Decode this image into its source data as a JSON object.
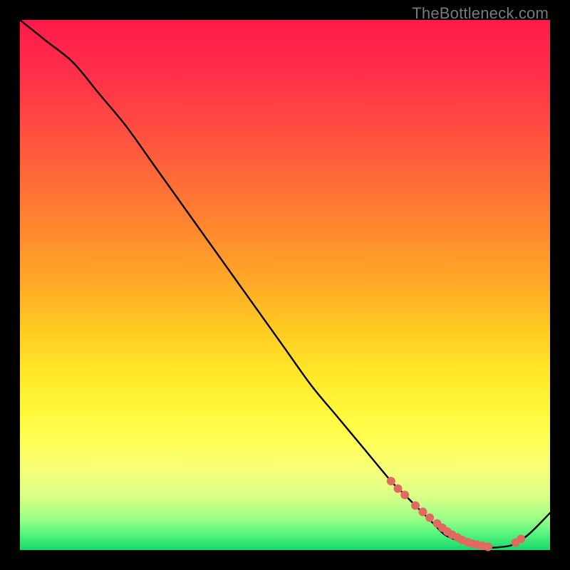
{
  "watermark": "TheBottleneck.com",
  "gradient": {
    "stops": [
      {
        "pos": 0.0,
        "color": "#ff1a4a"
      },
      {
        "pos": 0.1,
        "color": "#ff2f49"
      },
      {
        "pos": 0.2,
        "color": "#ff4b41"
      },
      {
        "pos": 0.3,
        "color": "#ff6a38"
      },
      {
        "pos": 0.4,
        "color": "#ff8a2e"
      },
      {
        "pos": 0.5,
        "color": "#ffab26"
      },
      {
        "pos": 0.58,
        "color": "#ffc922"
      },
      {
        "pos": 0.66,
        "color": "#ffe627"
      },
      {
        "pos": 0.74,
        "color": "#fff83b"
      },
      {
        "pos": 0.8,
        "color": "#ffff58"
      },
      {
        "pos": 0.85,
        "color": "#f6ff7a"
      },
      {
        "pos": 0.9,
        "color": "#d8ff88"
      },
      {
        "pos": 0.94,
        "color": "#9dff86"
      },
      {
        "pos": 0.97,
        "color": "#55f57e"
      },
      {
        "pos": 1.0,
        "color": "#17d66a"
      }
    ]
  },
  "chart_data": {
    "type": "line",
    "title": "",
    "xlabel": "",
    "ylabel": "",
    "xlim": [
      0,
      100
    ],
    "ylim": [
      0,
      100
    ],
    "grid": false,
    "legend": false,
    "series": [
      {
        "name": "bottleneck-curve",
        "x": [
          0,
          5,
          10,
          15,
          20,
          25,
          30,
          35,
          40,
          45,
          50,
          55,
          60,
          65,
          70,
          72,
          75,
          78,
          80,
          82,
          85,
          88,
          90,
          93,
          96,
          100
        ],
        "y": [
          100,
          96,
          92,
          86,
          80,
          73,
          66,
          59,
          52,
          45,
          38,
          31,
          25,
          19,
          13,
          11,
          8,
          5,
          3,
          2,
          1,
          0.5,
          0.5,
          1,
          3,
          7
        ]
      }
    ],
    "markers": {
      "name": "highlight-dots",
      "color": "#e06a5f",
      "radius_px": 6,
      "x": [
        70,
        71.3,
        72.6,
        74.6,
        76.0,
        77.3,
        78.7,
        79.7,
        80.6,
        81.5,
        82.5,
        83.4,
        84.4,
        85.3,
        86.3,
        87.3,
        88.3,
        93.5,
        94.5
      ],
      "y": [
        13.0,
        11.6,
        10.4,
        8.4,
        7.2,
        6.1,
        5.0,
        4.2,
        3.5,
        2.9,
        2.4,
        1.9,
        1.5,
        1.2,
        1.0,
        0.8,
        0.6,
        1.4,
        2.1
      ]
    }
  }
}
